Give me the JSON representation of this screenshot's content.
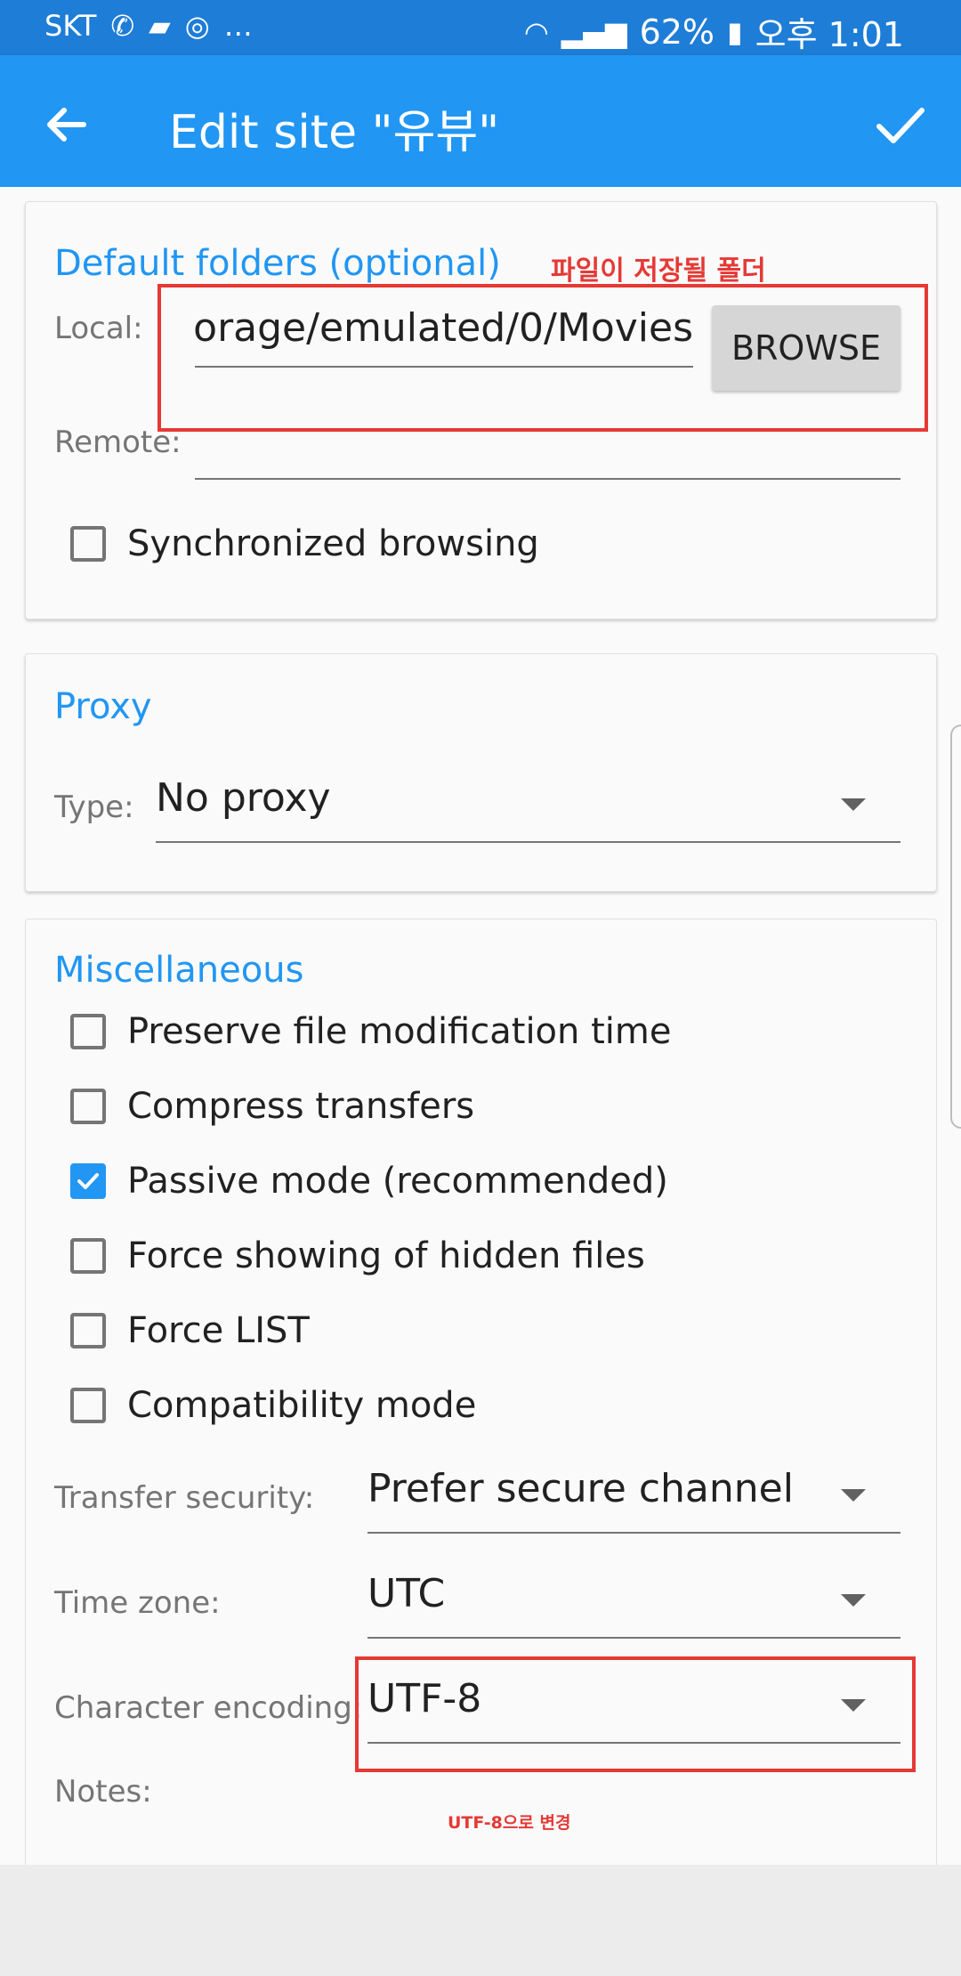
{
  "status_bar": {
    "carrier": "SKT",
    "battery": "62%",
    "time": "오후 1:01"
  },
  "app_bar": {
    "title": "Edit site \"유뷰\""
  },
  "default_folders": {
    "title": "Default folders (optional)",
    "local_label": "Local:",
    "local_value": "orage/emulated/0/Movies",
    "browse_label": "BROWSE",
    "remote_label": "Remote:",
    "remote_value": "",
    "sync_browsing_label": "Synchronized browsing",
    "sync_browsing_checked": false
  },
  "proxy": {
    "title": "Proxy",
    "type_label": "Type:",
    "type_value": "No proxy"
  },
  "misc": {
    "title": "Miscellaneous",
    "options": [
      {
        "label": "Preserve file modification time",
        "checked": false
      },
      {
        "label": "Compress transfers",
        "checked": false
      },
      {
        "label": "Passive mode (recommended)",
        "checked": true
      },
      {
        "label": "Force showing of hidden files",
        "checked": false
      },
      {
        "label": "Force LIST",
        "checked": false
      },
      {
        "label": "Compatibility mode",
        "checked": false
      }
    ],
    "transfer_security_label": "Transfer security:",
    "transfer_security_value": "Prefer secure channel",
    "time_zone_label": "Time zone:",
    "time_zone_value": "UTC",
    "encoding_label": "Character encoding:",
    "encoding_value": "UTF-8",
    "notes_label": "Notes:"
  },
  "annotations": {
    "folder_note": "파일이 저장될 폴더",
    "encoding_note": "UTF-8으로 변경"
  },
  "colors": {
    "accent": "#2196f3",
    "status_bar": "#1e7dd6",
    "annotation_red": "#e53935"
  },
  "icons": {
    "back": "arrow-left-icon",
    "confirm": "check-icon",
    "dropdown": "triangle-down-icon",
    "checkbox": "checkbox-icon"
  }
}
